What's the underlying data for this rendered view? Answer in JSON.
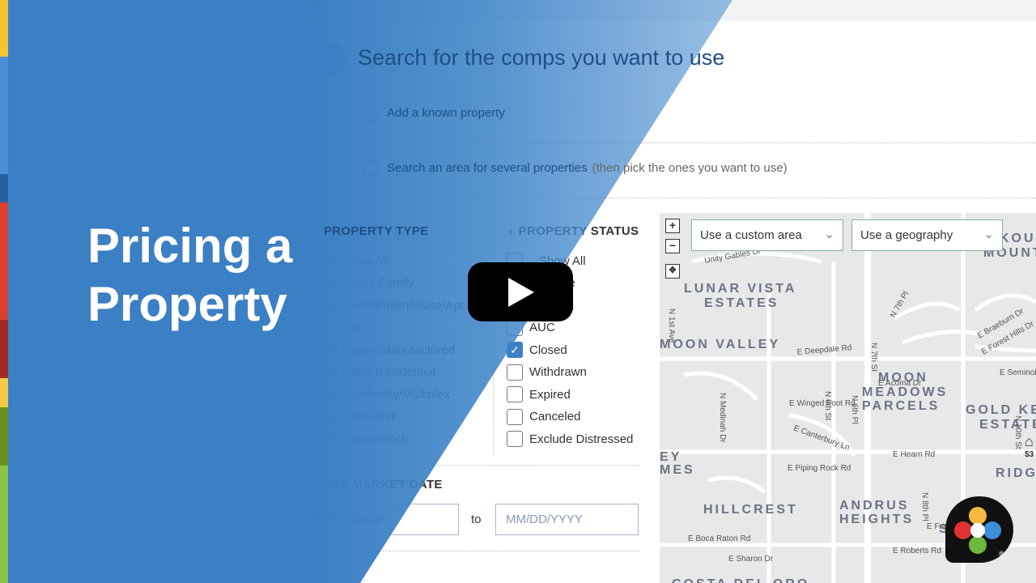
{
  "video": {
    "title_line1": "Pricing a",
    "title_line2": "Property",
    "play_icon": "play-icon"
  },
  "brand_stripe_colors": [
    "#f4c430",
    "#4a90d9",
    "#2a5f9e",
    "#d9412e",
    "#a02a20",
    "#f7c948",
    "#6b8e23",
    "#8bc34a"
  ],
  "accent": "#3b7fc4",
  "step": {
    "title": "Search for the comps you want to use",
    "options": [
      {
        "label": "Add a known property"
      },
      {
        "label": "Search an area for several properties",
        "hint": "(then pick the ones you want to use)"
      }
    ]
  },
  "property_type": {
    "label": "PROPERTY TYPE",
    "items": [
      "Show All",
      "Single Family",
      "Condo/Townhouse/Apt",
      "Loft",
      "Mobile/Manufactured",
      "Other Residential",
      "Multifamily/Multiplex",
      "Lots/Land",
      "Farm/Ranch"
    ]
  },
  "property_status": {
    "label": "PROPERTY STATUS",
    "items": [
      {
        "label": "Show All",
        "checked": false
      },
      {
        "label": "For Sale",
        "checked": false
      },
      {
        "label": "Pending",
        "checked": false
      },
      {
        "label": "AUC",
        "checked": false
      },
      {
        "label": "Closed",
        "checked": true
      },
      {
        "label": "Withdrawn",
        "checked": false
      },
      {
        "label": "Expired",
        "checked": false
      },
      {
        "label": "Canceled",
        "checked": false
      },
      {
        "label": "Exclude Distressed",
        "checked": false
      }
    ]
  },
  "off_market_date": {
    "label": "OFF MARKET DATE",
    "from_value": "2/20/2020",
    "to_label": "to",
    "to_placeholder": "MM/DD/YYYY"
  },
  "map": {
    "custom_area": "Use a custom area",
    "geography": "Use a geography",
    "neighborhoods": [
      "LUNAR VISTA",
      "ESTATES",
      "MOON VALLEY",
      "MOON",
      "MEADOWS",
      "PARCELS",
      "GOLD KEY",
      "ESTATES",
      "RIDGE",
      "HILLCREST",
      "ANDRUS",
      "HEIGHTS",
      "KOU",
      "MOUNTA",
      "EY",
      "MES",
      "SI",
      "ES",
      "COSTA DEL ORO"
    ],
    "streets": [
      "Unity Gables Dr",
      "E Deepdale Rd",
      "N 7th St",
      "E Acoma Dr",
      "E Winged Foot Rd",
      "N 1st Ave",
      "E Canterbury Ln",
      "N Medinah Dr",
      "E Piping Rock Rd",
      "E Hearn Rd",
      "E Boca Raton Rd",
      "E Sharon Dr",
      "E Roberts Rd",
      "E Braeburn Dr",
      "E Forest Hills Dr",
      "E Seminole",
      "N 10th St",
      "N 8th Pl",
      "E Friess Dr",
      "N 6th St",
      "N 6th Pl",
      "N 7th Pl"
    ],
    "price_marker": "$3"
  }
}
